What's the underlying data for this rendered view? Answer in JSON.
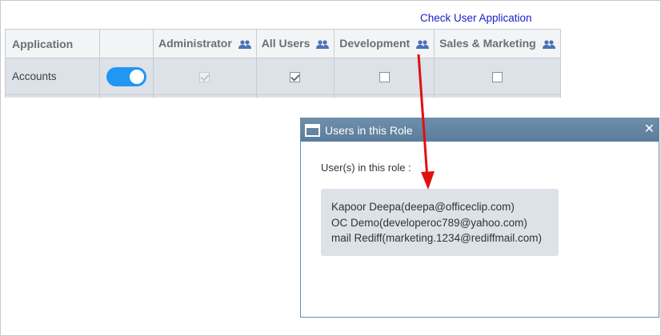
{
  "header": {
    "check_link": "Check User Application"
  },
  "table": {
    "columns": [
      "Application",
      "",
      "Administrator",
      "All Users",
      "Development",
      "Sales & Marketing"
    ],
    "rows": [
      {
        "name": "Accounts",
        "enabled": true,
        "administrator": {
          "checked": true,
          "disabled": true
        },
        "all_users": {
          "checked": true,
          "disabled": false
        },
        "development": {
          "checked": false,
          "disabled": false
        },
        "sales_marketing": {
          "checked": false,
          "disabled": false
        }
      }
    ]
  },
  "dialog": {
    "title": "Users in this Role",
    "close_glyph": "✕",
    "label": "User(s) in this role :",
    "users": [
      "Kapoor Deepa(deepa@officeclip.com)",
      "OC Demo(developeroc789@yahoo.com)",
      "mail Rediff(marketing.1234@rediffmail.com)"
    ]
  },
  "icons": {
    "role_users": "users-icon",
    "window": "window-icon",
    "close": "close-icon"
  },
  "colors": {
    "link": "#1a21c8",
    "toggle_on": "#2196f3",
    "arrow": "#e01010",
    "titlebar": "#5f809e"
  }
}
